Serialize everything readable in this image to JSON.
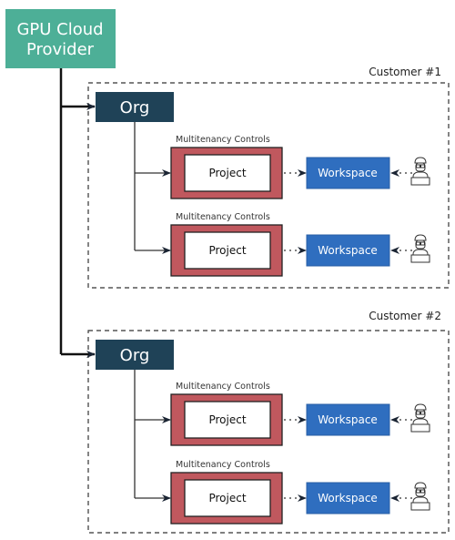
{
  "provider": {
    "label_line1": "GPU Cloud",
    "label_line2": "Provider"
  },
  "customers": [
    {
      "label": "Customer #1",
      "org": "Org",
      "projects": [
        {
          "controls_label": "Multitenancy Controls",
          "project": "Project",
          "workspace": "Workspace",
          "user_icon": "developer-icon"
        },
        {
          "controls_label": "Multitenancy Controls",
          "project": "Project",
          "workspace": "Workspace",
          "user_icon": "developer-icon"
        }
      ]
    },
    {
      "label": "Customer #2",
      "org": "Org",
      "projects": [
        {
          "controls_label": "Multitenancy Controls",
          "project": "Project",
          "workspace": "Workspace",
          "user_icon": "developer-icon"
        },
        {
          "controls_label": "Multitenancy Controls",
          "project": "Project",
          "workspace": "Workspace",
          "user_icon": "developer-icon"
        }
      ]
    }
  ],
  "colors": {
    "provider": "#4DAF97",
    "org": "#1F4257",
    "controls": "#C0585E",
    "workspace": "#2F6EBF"
  }
}
